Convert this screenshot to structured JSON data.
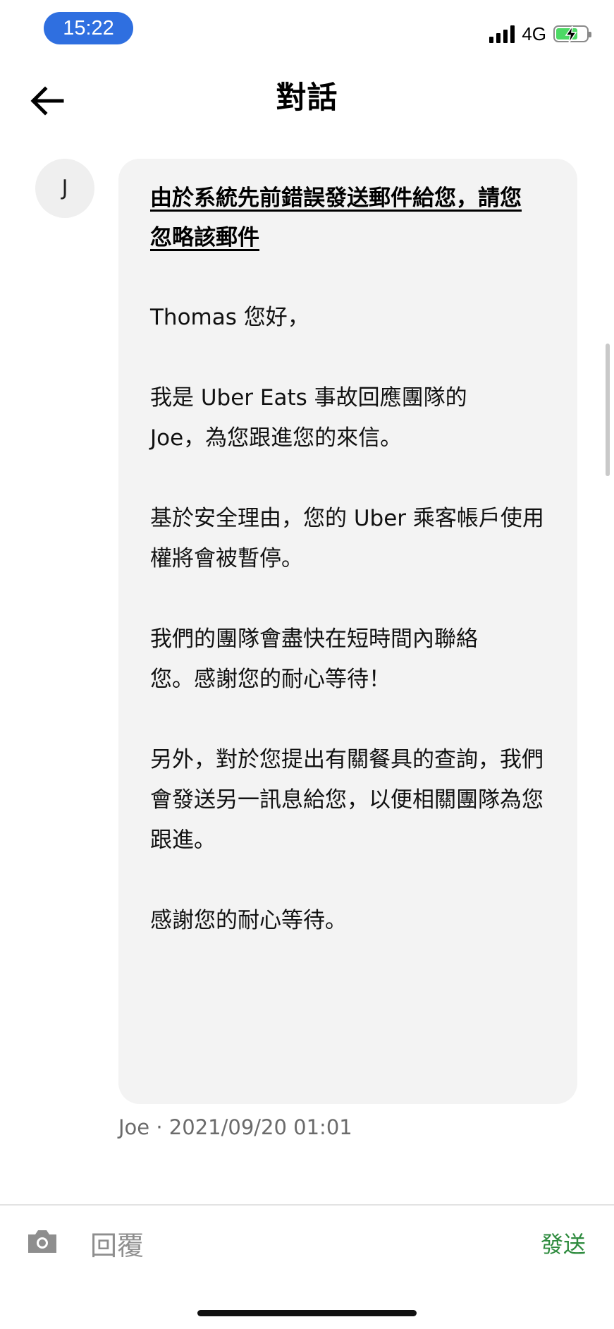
{
  "status_bar": {
    "time": "15:22",
    "network": "4G",
    "icons": [
      "signal-icon",
      "battery-charging-icon"
    ]
  },
  "header": {
    "title": "對話",
    "back_icon": "arrow-left-icon"
  },
  "message": {
    "avatar_initial": "J",
    "subject": "由於系統先前錯誤發送郵件給您，請您忽略該郵件",
    "paragraphs": [
      "Thomas 您好，",
      "我是 Uber Eats 事故回應團隊的 Joe，為您跟進您的來信。",
      "基於安全理由，您的 Uber 乘客帳戶使用權將會被暫停。",
      "我們的團隊會盡快在短時間內聯絡您。感謝您的耐心等待！",
      "另外，對於您提出有關餐具的查詢，我們會發送另一訊息給您，以便相關團隊為您跟進。",
      "感謝您的耐心等待。"
    ],
    "meta": "Joe · 2021/09/20 01:01"
  },
  "reply_bar": {
    "camera_icon": "camera-icon",
    "placeholder": "回覆",
    "send_label": "發送",
    "accent_color": "#2e8b3e"
  }
}
